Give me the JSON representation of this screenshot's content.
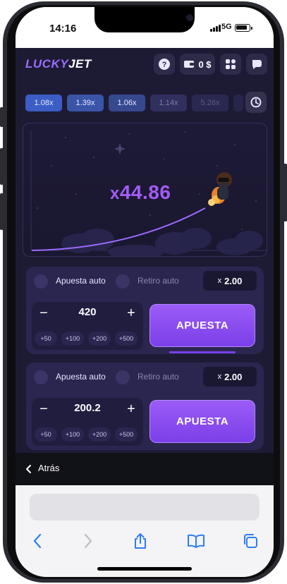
{
  "status": {
    "time": "14:16",
    "network": "5G"
  },
  "app": {
    "logo_part1": "LUCKY",
    "logo_part2": "JET",
    "balance": "0 $"
  },
  "history": [
    "1.08x",
    "1.39x",
    "1.06x",
    "1.14x",
    "5.26x"
  ],
  "game": {
    "multiplier_prefix": "x",
    "multiplier": "44.86"
  },
  "panels": [
    {
      "auto_bet_label": "Apuesta auto",
      "auto_cashout_label": "Retiro auto",
      "cashout_prefix": "x",
      "cashout_value": "2.00",
      "minus": "−",
      "plus": "+",
      "stake": "420",
      "quick": [
        "+50",
        "+100",
        "+200",
        "+500"
      ],
      "bet_label": "APUESTA"
    },
    {
      "auto_bet_label": "Apuesta auto",
      "auto_cashout_label": "Retiro auto",
      "cashout_prefix": "x",
      "cashout_value": "2.00",
      "minus": "−",
      "plus": "+",
      "stake": "200.2",
      "quick": [
        "+50",
        "+100",
        "+200",
        "+500"
      ],
      "bet_label": "APUESTA"
    }
  ],
  "browser": {
    "back_label": "Atrás"
  },
  "colors": {
    "app_bg": "#1d1b34",
    "accent": "#9d6bff",
    "bet_button": "#8a4cf2",
    "multiplier": "#a35cf5",
    "ios_blue": "#2f7cf6"
  },
  "icons": {
    "header": [
      "help-icon",
      "wallet-icon",
      "menu-grid-icon",
      "chat-icon"
    ],
    "history": "clock-icon",
    "toolbar": [
      "back-arrow-icon",
      "forward-arrow-icon",
      "share-icon",
      "bookmarks-icon",
      "tabs-icon"
    ]
  }
}
